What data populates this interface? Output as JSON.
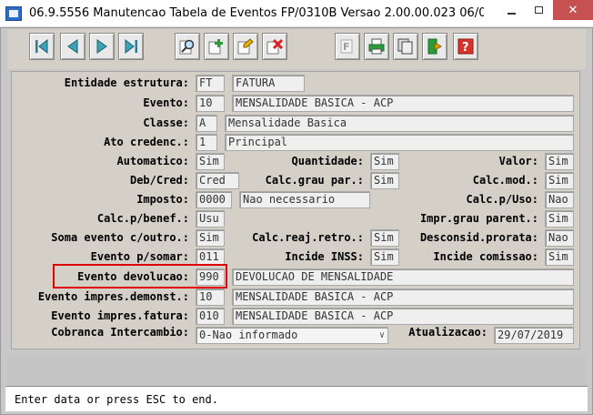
{
  "window": {
    "title": "06.9.5556 Manutencao  Tabela de Eventos FP/0310B Versao 2.00.00.023 06/0..."
  },
  "toolbar": {
    "buttons": [
      {
        "name": "first-record",
        "icon": "first-record-icon"
      },
      {
        "name": "previous-record",
        "icon": "previous-record-icon"
      },
      {
        "name": "next-record",
        "icon": "next-record-icon"
      },
      {
        "name": "last-record",
        "icon": "last-record-icon"
      },
      {
        "name": "search",
        "icon": "search-icon"
      },
      {
        "name": "add",
        "icon": "add-icon"
      },
      {
        "name": "edit",
        "icon": "edit-icon"
      },
      {
        "name": "delete",
        "icon": "delete-icon"
      },
      {
        "name": "filter",
        "icon": "filter-icon"
      },
      {
        "name": "print",
        "icon": "print-icon"
      },
      {
        "name": "copy",
        "icon": "copy-icon"
      },
      {
        "name": "exit",
        "icon": "exit-icon"
      },
      {
        "name": "help",
        "icon": "help-icon"
      }
    ]
  },
  "form": {
    "entidade": {
      "label": "Entidade estrutura:",
      "code": "FT",
      "desc": "FATURA"
    },
    "evento": {
      "label": "Evento:",
      "code": "10",
      "desc": "MENSALIDADE BASICA - ACP"
    },
    "classe": {
      "label": "Classe:",
      "code": "A",
      "desc": "Mensalidade Basica"
    },
    "ato": {
      "label": "Ato credenc.:",
      "code": "1",
      "desc": "Principal"
    },
    "automatico": {
      "label": "Automatico:",
      "value": "Sim"
    },
    "quantidade": {
      "label": "Quantidade:",
      "value": "Sim"
    },
    "valor": {
      "label": "Valor:",
      "value": "Sim"
    },
    "debcred": {
      "label": "Deb/Cred:",
      "value": "Cred"
    },
    "calc_grau": {
      "label": "Calc.grau par.:",
      "value": "Sim"
    },
    "calc_mod": {
      "label": "Calc.mod.:",
      "value": "Sim"
    },
    "imposto": {
      "label": "Imposto:",
      "code": "0000",
      "desc": "Nao necessario"
    },
    "calc_uso": {
      "label": "Calc.p/Uso:",
      "value": "Nao"
    },
    "calc_benef": {
      "label": "Calc.p/benef.:",
      "value": "Usu"
    },
    "impr_grau": {
      "label": "Impr.grau parent.:",
      "value": "Sim"
    },
    "soma_evento": {
      "label": "Soma evento c/outro.:",
      "value": "Sim"
    },
    "calc_reaj": {
      "label": "Calc.reaj.retro.:",
      "value": "Sim"
    },
    "desconsid": {
      "label": "Desconsid.prorata:",
      "value": "Nao"
    },
    "evento_somar": {
      "label": "Evento p/somar:",
      "value": "011"
    },
    "incide_inss": {
      "label": "Incide INSS:",
      "value": "Sim"
    },
    "incide_comissao": {
      "label": "Incide comissao:",
      "value": "Sim"
    },
    "evento_devolucao": {
      "label": "Evento devolucao:",
      "code": "990",
      "desc": "DEVOLUCAO DE MENSALIDADE"
    },
    "evento_impres_demonst": {
      "label": "Evento impres.demonst.:",
      "code": "10",
      "desc": "MENSALIDADE BASICA - ACP"
    },
    "evento_impres_fatura": {
      "label": "Evento impres.fatura:",
      "code": "010",
      "desc": "MENSALIDADE BASICA - ACP"
    },
    "cobranca": {
      "label": "Cobranca Intercambio:",
      "value": "0-Nao informado"
    },
    "atualizacao": {
      "label": "Atualizacao:",
      "value": "29/07/2019"
    }
  },
  "status": {
    "message": "Enter data or press ESC to end."
  },
  "colors": {
    "highlight": "#e00000",
    "panel": "#d4d0c8"
  }
}
